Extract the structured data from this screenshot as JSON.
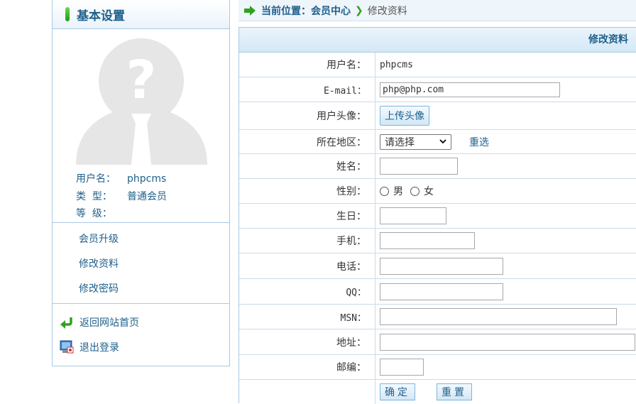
{
  "sidebar": {
    "title": "基本设置",
    "user": {
      "username_label": "用户名：",
      "username_value": "phpcms",
      "type_label": "类  型：",
      "type_value": "普通会员",
      "level_label": "等  级：",
      "level_value": ""
    },
    "menu": [
      "会员升级",
      "修改资料",
      "修改密码"
    ],
    "links": {
      "home": "返回网站首页",
      "logout": "退出登录"
    }
  },
  "breadcrumb": {
    "location": "当前位置：会员中心",
    "current": "修改资料"
  },
  "panel": {
    "title": "修改资料"
  },
  "form": {
    "username_label": "用户名：",
    "username_value": "phpcms",
    "email_label": "E-mail：",
    "email_value": "php@php.com",
    "avatar_label": "用户头像：",
    "upload_button": "上传头像",
    "region_label": "所在地区：",
    "region_value": "请选择",
    "reselect": "重选",
    "name_label": "姓名：",
    "gender_label": "性别：",
    "gender_male": "男",
    "gender_female": "女",
    "birthday_label": "生日：",
    "mobile_label": "手机：",
    "phone_label": "电话：",
    "qq_label": "QQ：",
    "msn_label": "MSN：",
    "address_label": "地址：",
    "zip_label": "邮编：",
    "submit": "确定",
    "reset": "重置"
  }
}
